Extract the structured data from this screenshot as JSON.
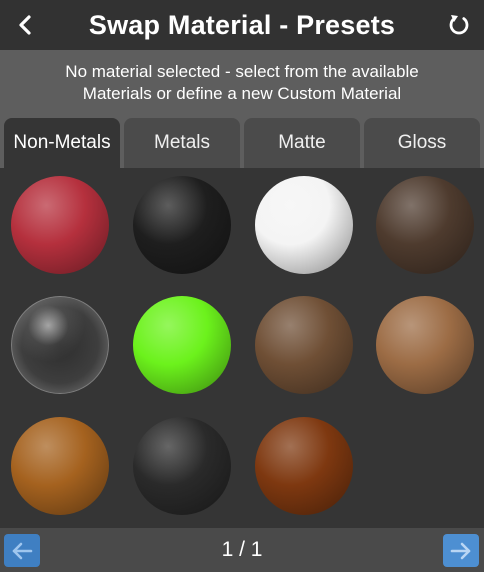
{
  "header": {
    "title": "Swap Material - Presets",
    "back_icon": "chevron-left-icon",
    "reset_icon": "reset-rotate-icon"
  },
  "info": {
    "line1": "No material selected - select from the available",
    "line2": "Materials or define a new Custom Material"
  },
  "tabs": [
    {
      "label": "Non-Metals",
      "active": true
    },
    {
      "label": "Metals",
      "active": false
    },
    {
      "label": "Matte",
      "active": false
    },
    {
      "label": "Gloss",
      "active": false
    }
  ],
  "materials": [
    {
      "name": "red",
      "color": "#b5303d"
    },
    {
      "name": "black",
      "color": "#1e1e1e"
    },
    {
      "name": "white",
      "color": "#f4f4f4"
    },
    {
      "name": "dark-brown",
      "color": "#4e3b2e"
    },
    {
      "name": "glass",
      "color": "#5a5a5a"
    },
    {
      "name": "lime-green",
      "color": "#6cf21c"
    },
    {
      "name": "brown",
      "color": "#6f4f35"
    },
    {
      "name": "tan",
      "color": "#9c6c45"
    },
    {
      "name": "orange-brown",
      "color": "#a5621f"
    },
    {
      "name": "charcoal",
      "color": "#2a2a2a"
    },
    {
      "name": "rust-brown",
      "color": "#7e3810"
    }
  ],
  "footer": {
    "page": "1 / 1",
    "prev_icon": "arrow-left-icon",
    "next_icon": "arrow-right-icon"
  },
  "colors": {
    "accent": "#4d8fd2",
    "panel": "#353535",
    "band": "#5e5e5e"
  }
}
